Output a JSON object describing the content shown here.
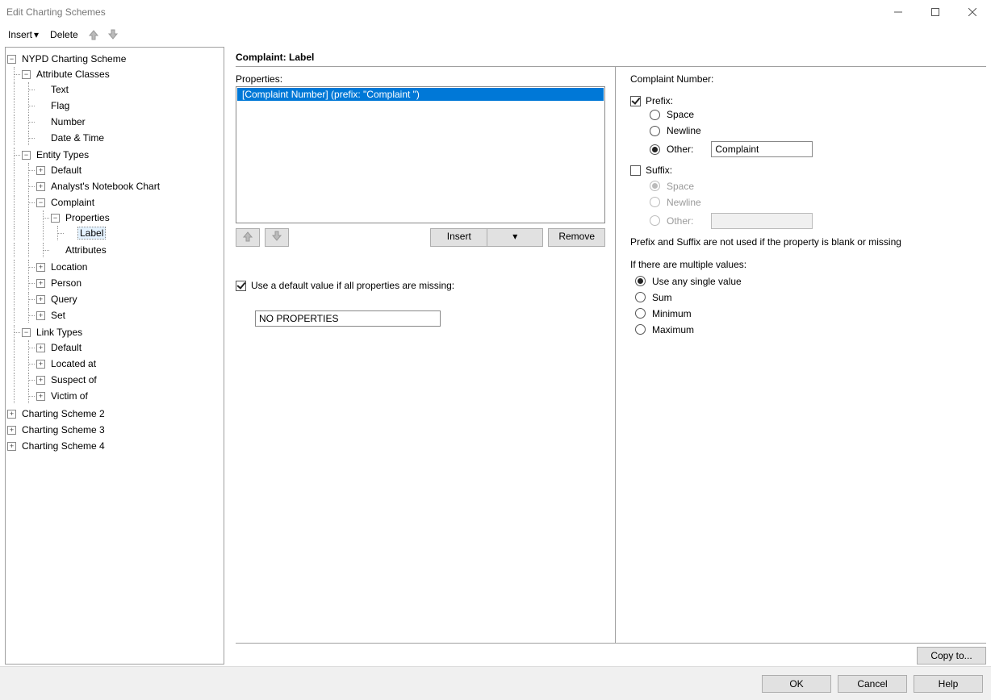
{
  "window": {
    "title": "Edit Charting Schemes"
  },
  "toolbar": {
    "insert": "Insert",
    "delete": "Delete"
  },
  "tree": {
    "root": "NYPD Charting Scheme",
    "attr_classes": "Attribute Classes",
    "attr_text": "Text",
    "attr_flag": "Flag",
    "attr_number": "Number",
    "attr_datetime": "Date & Time",
    "entity_types": "Entity Types",
    "et_default": "Default",
    "et_anb": "Analyst's Notebook Chart",
    "et_complaint": "Complaint",
    "et_complaint_properties": "Properties",
    "et_complaint_label": "Label",
    "et_complaint_attributes": "Attributes",
    "et_location": "Location",
    "et_person": "Person",
    "et_query": "Query",
    "et_set": "Set",
    "link_types": "Link Types",
    "lt_default": "Default",
    "lt_located": "Located at",
    "lt_suspect": "Suspect of",
    "lt_victim": "Victim of",
    "cs2": "Charting Scheme 2",
    "cs3": "Charting Scheme 3",
    "cs4": "Charting Scheme 4"
  },
  "header": "Complaint: Label",
  "left": {
    "properties_label": "Properties:",
    "list_item": "[Complaint Number]  (prefix: \"Complaint \")",
    "insert": "Insert",
    "remove": "Remove",
    "use_default_label": "Use a default value if all properties are missing:",
    "default_value": "NO PROPERTIES"
  },
  "right": {
    "prop_header": "Complaint Number:",
    "prefix": "Prefix:",
    "space": "Space",
    "newline": "Newline",
    "other": "Other:",
    "other_value": "Complaint ",
    "suffix": "Suffix:",
    "note": "Prefix and Suffix are not used if the property is blank or missing",
    "multi": "If there are multiple values:",
    "opt_any": "Use any single value",
    "opt_sum": "Sum",
    "opt_min": "Minimum",
    "opt_max": "Maximum"
  },
  "copy_to": "Copy to...",
  "footer": {
    "ok": "OK",
    "cancel": "Cancel",
    "help": "Help"
  }
}
